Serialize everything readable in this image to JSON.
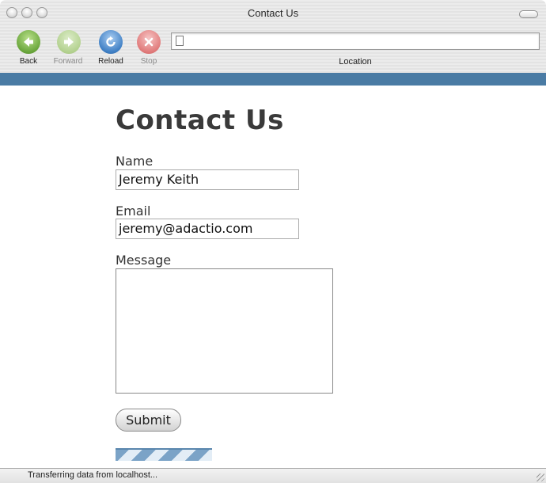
{
  "window": {
    "title": "Contact Us"
  },
  "toolbar": {
    "back_label": "Back",
    "forward_label": "Forward",
    "reload_label": "Reload",
    "stop_label": "Stop",
    "location_label": "Location",
    "address_value": ""
  },
  "page": {
    "heading": "Contact Us",
    "name_label": "Name",
    "name_value": "Jeremy Keith",
    "email_label": "Email",
    "email_value": "jeremy@adactio.com",
    "message_label": "Message",
    "message_value": "",
    "submit_label": "Submit"
  },
  "status": {
    "text": "Transferring data from localhost..."
  },
  "colors": {
    "accent_bar": "#4a7ba4",
    "back_button": "#6aa63c",
    "reload_button": "#3f7fc4",
    "stop_button": "#e07a7a"
  }
}
